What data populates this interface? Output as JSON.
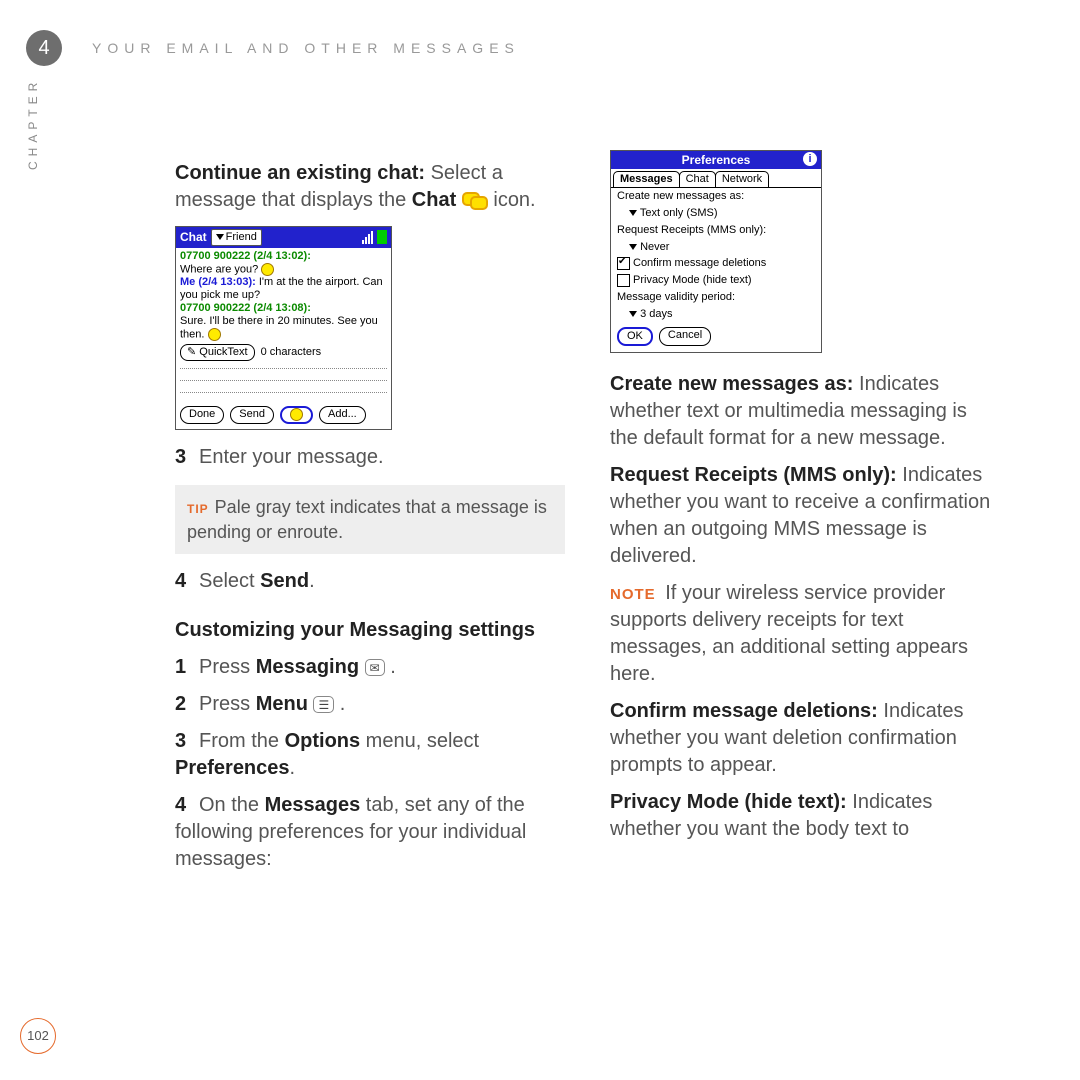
{
  "header": {
    "chapter_num": "4",
    "running_head": "YOUR EMAIL AND OTHER MESSAGES",
    "side_label": "CHAPTER"
  },
  "page_number": "102",
  "left": {
    "intro_bold": "Continue an existing chat:",
    "intro_rest": " Select a message that displays the ",
    "intro_bold2": "Chat",
    "intro_end": " icon.",
    "step3_num": "3",
    "step3_text": "Enter your message.",
    "tip_label": "TIP",
    "tip_text": "Pale gray text indicates that a message is pending or enroute.",
    "step4_num": "4",
    "step4_pre": "Select ",
    "step4_bold": "Send",
    "step4_post": ".",
    "subhead": "Customizing your Messaging settings",
    "cs1_num": "1",
    "cs1_pre": "Press ",
    "cs1_bold": "Messaging",
    "cs1_post": " ",
    "cs2_num": "2",
    "cs2_pre": "Press ",
    "cs2_bold": "Menu",
    "cs2_post": " ",
    "cs3_num": "3",
    "cs3_pre": "From the ",
    "cs3_bold": "Options",
    "cs3_mid": " menu, select ",
    "cs3_bold2": "Preferences",
    "cs3_post": ".",
    "cs4_num": "4",
    "cs4_pre": "On the ",
    "cs4_bold": "Messages",
    "cs4_post": " tab, set any of the following preferences for your individual messages:"
  },
  "right": {
    "p1_bold": "Create new messages as:",
    "p1_rest": " Indicates whether text or multimedia messaging is the default format for a new message.",
    "p2_bold": "Request Receipts (MMS only):",
    "p2_rest": " Indicates whether you want to receive a confirmation when an outgoing MMS message is delivered.",
    "note_label": "NOTE",
    "note_rest": " If your wireless service provider supports delivery receipts for text messages, an additional setting appears here.",
    "p3_bold": "Confirm message deletions:",
    "p3_rest": " Indicates whether you want deletion confirmation prompts to appear.",
    "p4_bold": "Privacy Mode (hide text):",
    "p4_rest": " Indicates whether you want the body text to"
  },
  "dev1": {
    "title": "Chat",
    "friend": "Friend",
    "l1": "07700 900222  (2/4 13:02):",
    "l2": "Where are you?",
    "l3a": "Me (2/4 13:03):",
    "l3b": " I'm at the the airport.  Can you pick me up?",
    "l4": "07700 900222  (2/4 13:08):",
    "l5": "Sure.  I'll be there in 20 minutes.  See you then.",
    "qt": "QuickText",
    "chars": "0 characters",
    "b_done": "Done",
    "b_send": "Send",
    "b_add": "Add..."
  },
  "dev2": {
    "title": "Preferences",
    "tab1": "Messages",
    "tab2": "Chat",
    "tab3": "Network",
    "r1": "Create new messages as:",
    "r1v": "Text only (SMS)",
    "r2": "Request Receipts (MMS only):",
    "r2v": "Never",
    "cb1": "Confirm message deletions",
    "cb2": "Privacy Mode (hide text)",
    "r3": "Message validity period:",
    "r3v": "3 days",
    "ok": "OK",
    "cancel": "Cancel"
  }
}
